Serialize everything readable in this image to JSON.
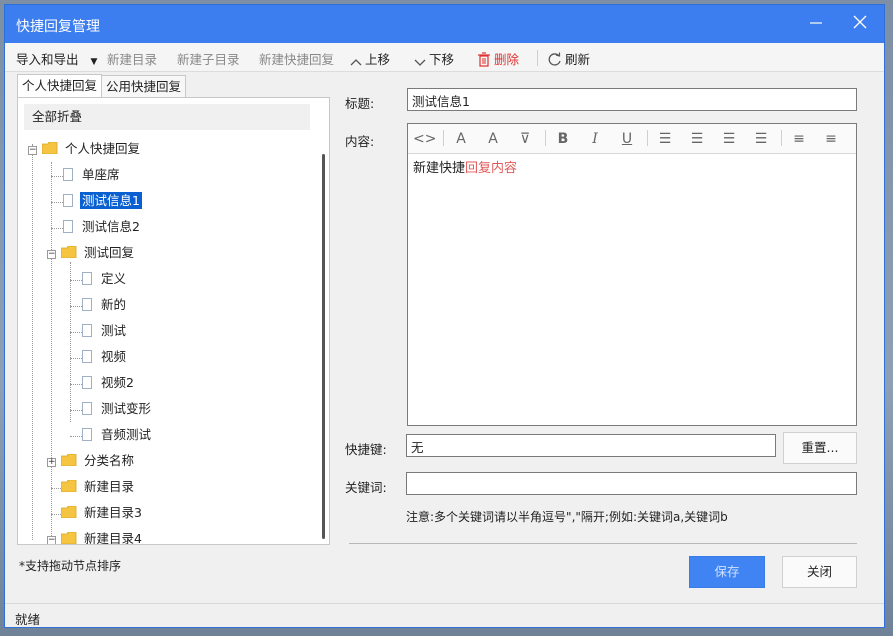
{
  "window": {
    "title": "快捷回复管理"
  },
  "toolbar": {
    "import_export": "导入和导出",
    "new_dir": "新建目录",
    "new_subdir": "新建子目录",
    "new_reply": "新建快捷回复",
    "move_up": "上移",
    "move_down": "下移",
    "delete": "删除",
    "refresh": "刷新"
  },
  "tabs": [
    "个人快捷回复",
    "公用快捷回复"
  ],
  "tree": {
    "collapse_all": "全部折叠",
    "root": "个人快捷回复",
    "items": [
      {
        "label": "单座席"
      },
      {
        "label": "测试信息1"
      },
      {
        "label": "测试信息2"
      },
      {
        "label": "测试回复"
      },
      {
        "label": "定义"
      },
      {
        "label": "新的"
      },
      {
        "label": "测试"
      },
      {
        "label": "视频"
      },
      {
        "label": "视频2"
      },
      {
        "label": "测试变形"
      },
      {
        "label": "音频测试"
      },
      {
        "label": "分类名称"
      },
      {
        "label": "新建目录"
      },
      {
        "label": "新建目录3"
      },
      {
        "label": "新建目录4"
      }
    ]
  },
  "form": {
    "title_label": "标题:",
    "title_value": "测试信息1",
    "content_label": "内容:",
    "content_black": "新建快捷",
    "content_red": "回复内容",
    "hotkey_label": "快捷键:",
    "hotkey_value": "无",
    "reset_label": "重置...",
    "keyword_label": "关键词:",
    "keyword_value": "",
    "keyword_note": "注意:多个关键词请以半角逗号\",\"隔开;例如:关键词a,关键词b"
  },
  "footer": {
    "drag_note": "*支持拖动节点排序",
    "save": "保存",
    "close": "关闭"
  },
  "status": {
    "text": "就绪"
  },
  "colors": {
    "accent": "#3c7ef0",
    "selected": "#0a5fd1",
    "delete": "#e03030",
    "folder": "#f5c542"
  }
}
